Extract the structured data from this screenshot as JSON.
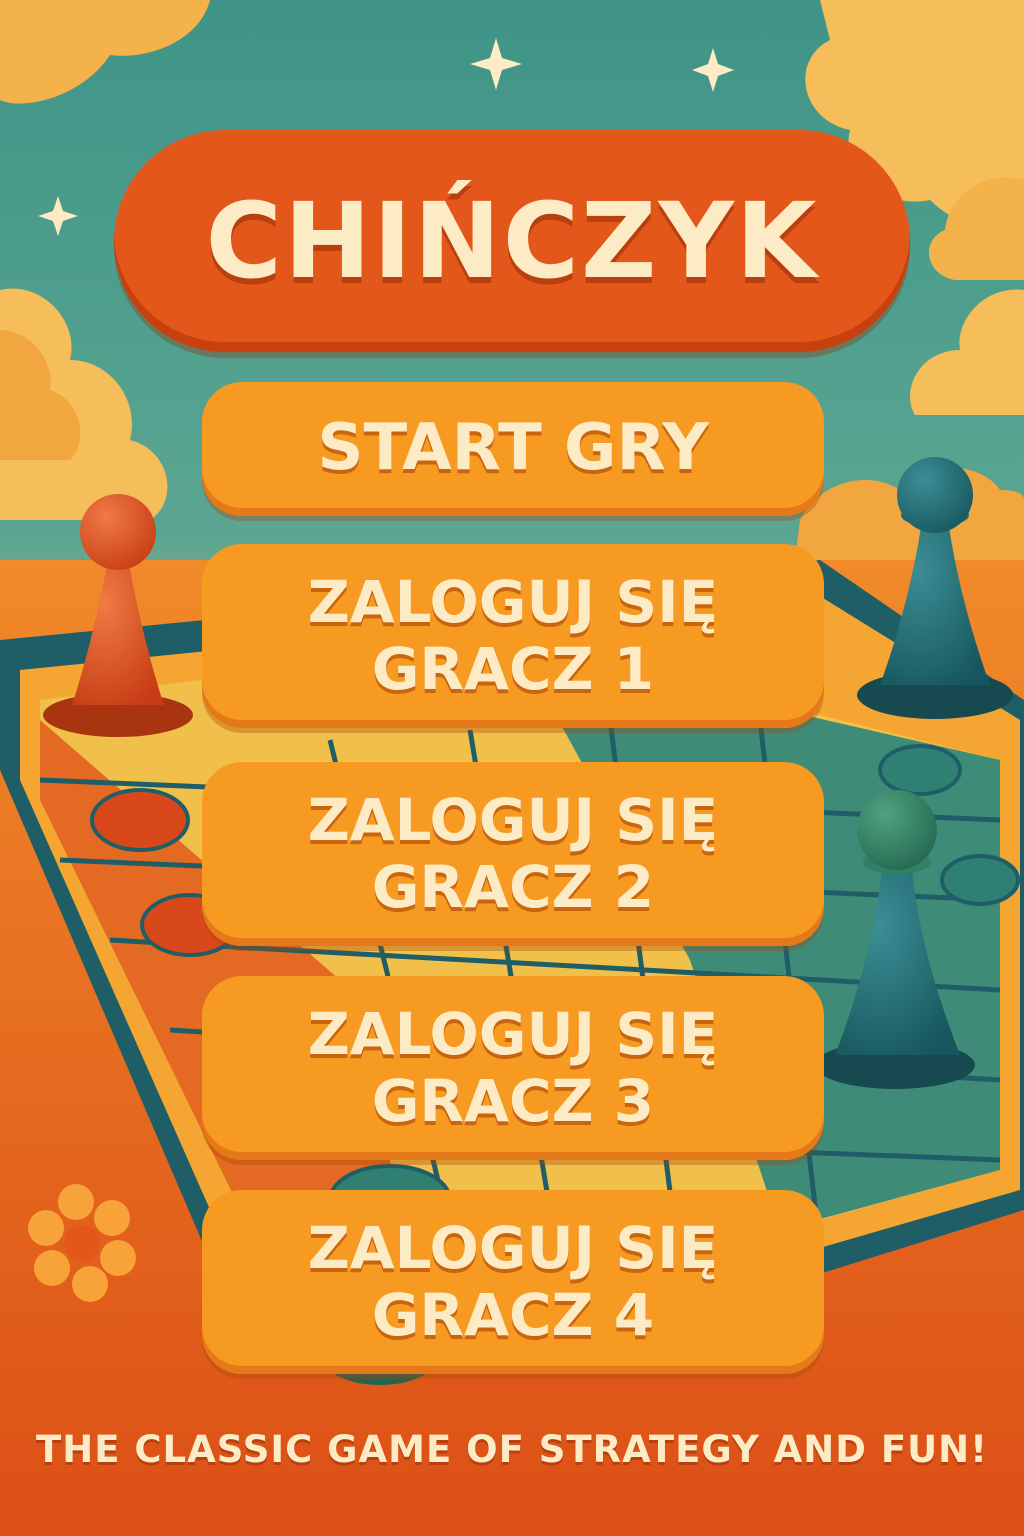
{
  "title": "CHIŃCZYK",
  "menu": {
    "start": "START GRY",
    "login_label": "ZALOGUJ SIĘ",
    "players": [
      "GRACZ 1",
      "GRACZ 2",
      "GRACZ 3",
      "GRACZ 4"
    ]
  },
  "tagline": "THE CLASSIC GAME OF STRATEGY AND FUN!",
  "colors": {
    "sky": "#4E9E8E",
    "title_pill": "#E4571A",
    "button": "#F79A22",
    "text": "#FCEBC4",
    "pawn_red": "#D9481A",
    "pawn_teal": "#1F6B73",
    "pawn_green": "#2F8166"
  },
  "decorations": {
    "icons": [
      "star-icon",
      "flower-icon",
      "red-pawn",
      "teal-pawn",
      "green-pawn",
      "ludo-board"
    ]
  }
}
